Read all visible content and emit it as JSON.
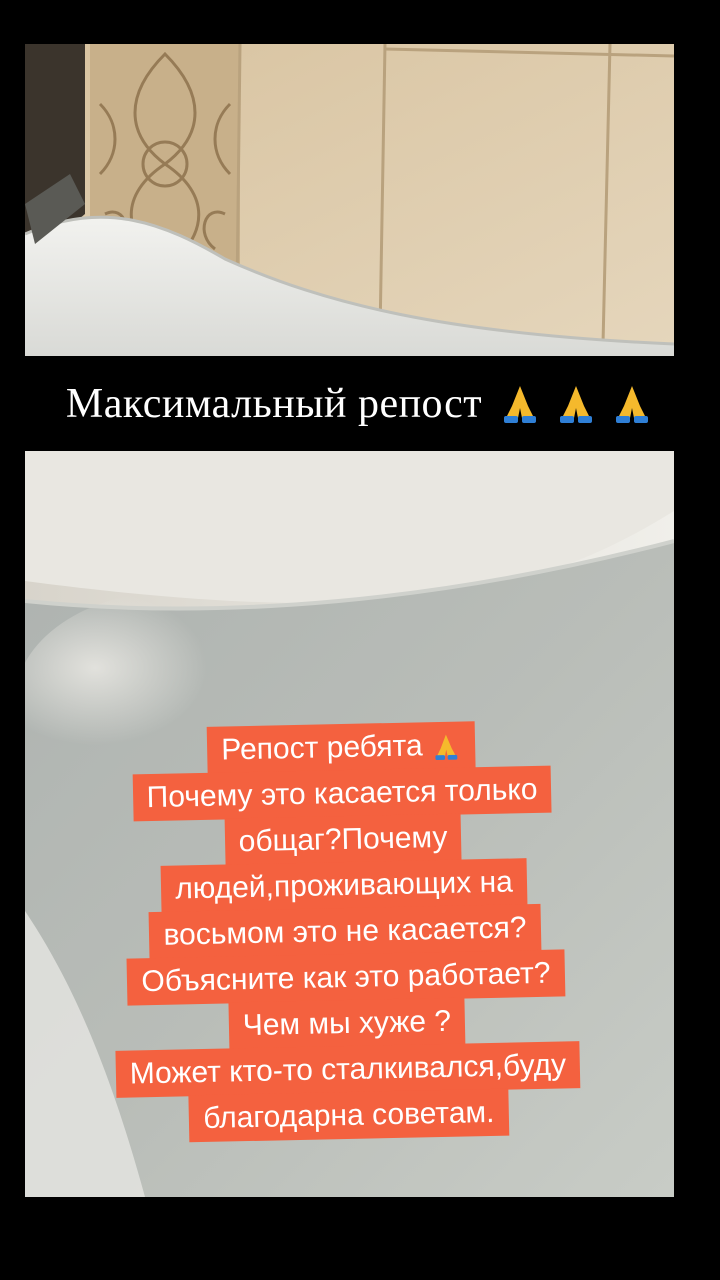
{
  "caption": {
    "text": "Максимальный репост",
    "emoji": [
      "pray-icon",
      "pray-icon",
      "pray-icon"
    ]
  },
  "sticker": {
    "lines": [
      "Репост ребята",
      "Почему это касается только",
      "общаг?Почему",
      "людей,проживающих на",
      "восьмом это не касается?",
      "Объясните как это работает?",
      "Чем мы хуже ?",
      "Может кто-то сталкивался,буду",
      "благодарна советам."
    ],
    "first_line_emoji": "pray-icon"
  },
  "colors": {
    "background": "#000000",
    "sticker_bg": "#f4613f",
    "text": "#ffffff"
  }
}
